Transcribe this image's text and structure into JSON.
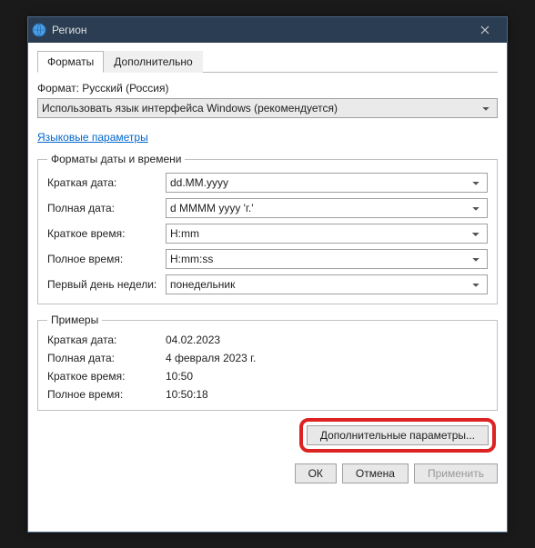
{
  "titlebar": {
    "title": "Регион"
  },
  "tabs": {
    "formats": "Форматы",
    "additional": "Дополнительно"
  },
  "format": {
    "label": "Формат: Русский (Россия)",
    "value": "Использовать язык интерфейса Windows (рекомендуется)"
  },
  "link": "Языковые параметры",
  "group_formats": {
    "legend": "Форматы даты и времени",
    "short_date_label": "Краткая дата:",
    "short_date_value": "dd.MM.yyyy",
    "long_date_label": "Полная дата:",
    "long_date_value": "d MMMM yyyy 'г.'",
    "short_time_label": "Краткое время:",
    "short_time_value": "H:mm",
    "long_time_label": "Полное время:",
    "long_time_value": "H:mm:ss",
    "first_day_label": "Первый день недели:",
    "first_day_value": "понедельник"
  },
  "group_examples": {
    "legend": "Примеры",
    "short_date_label": "Краткая дата:",
    "short_date_value": "04.02.2023",
    "long_date_label": "Полная дата:",
    "long_date_value": "4 февраля 2023 г.",
    "short_time_label": "Краткое время:",
    "short_time_value": "10:50",
    "long_time_label": "Полное время:",
    "long_time_value": "10:50:18"
  },
  "buttons": {
    "additional": "Дополнительные параметры...",
    "ok": "ОК",
    "cancel": "Отмена",
    "apply": "Применить"
  }
}
